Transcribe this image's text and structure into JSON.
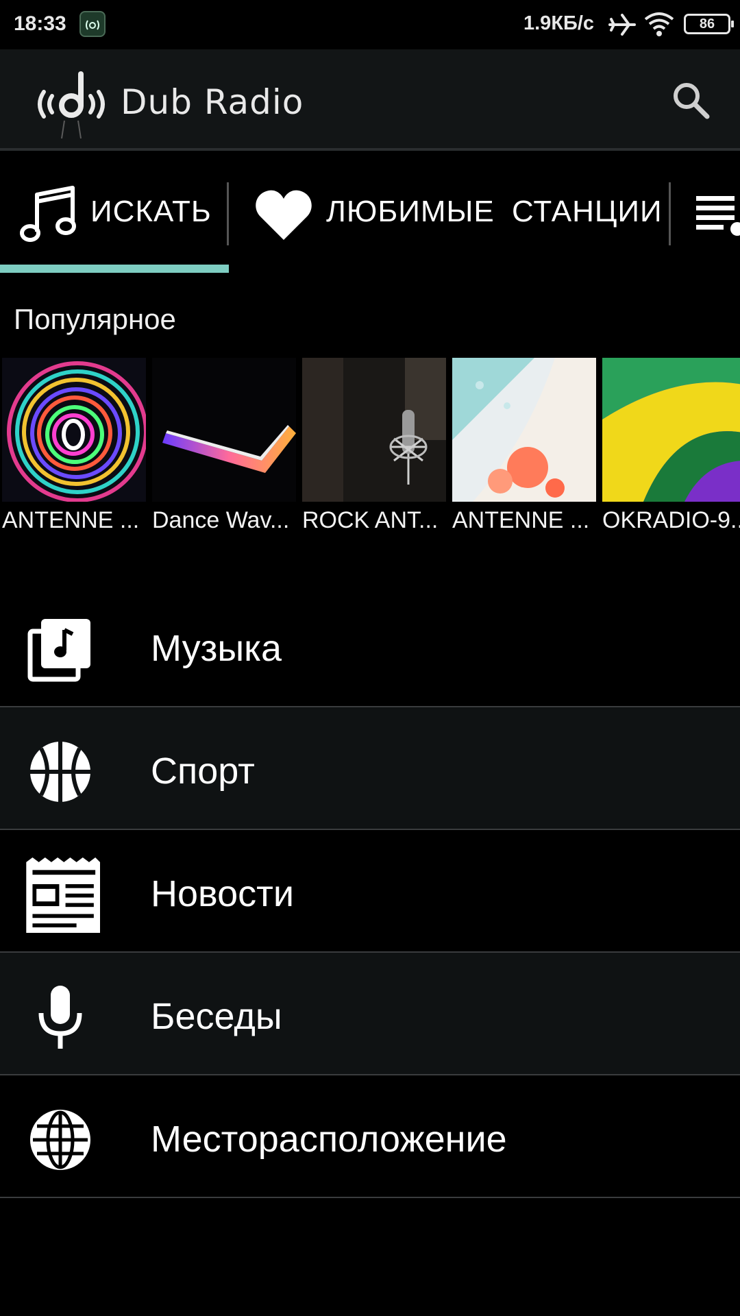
{
  "status_bar": {
    "time": "18:33",
    "speed": "1.9КБ/с",
    "battery": "86"
  },
  "app_bar": {
    "brand": "Dub Radio",
    "search_icon": "search-icon"
  },
  "tabs": [
    {
      "label": "ИСКАТЬ",
      "icon": "music-note-icon",
      "active": true
    },
    {
      "label": "ЛЮБИМЫЕ СТАНЦИИ",
      "icon": "heart-icon",
      "active": false
    },
    {
      "label": "",
      "icon": "playlist-icon",
      "active": false
    }
  ],
  "accent_color": "#7ecdc2",
  "popular": {
    "title": "Популярное",
    "stations": [
      {
        "name": "ANTENNE ..."
      },
      {
        "name": "Dance Wav..."
      },
      {
        "name": "ROCK ANT..."
      },
      {
        "name": "ANTENNE ..."
      },
      {
        "name": "OKRADIO-9..."
      }
    ]
  },
  "categories": [
    {
      "label": "Музыка",
      "icon": "music-library-icon"
    },
    {
      "label": "Спорт",
      "icon": "basketball-icon"
    },
    {
      "label": "Новости",
      "icon": "newspaper-icon"
    },
    {
      "label": "Беседы",
      "icon": "microphone-icon"
    },
    {
      "label": "Месторасположение",
      "icon": "globe-icon"
    }
  ]
}
